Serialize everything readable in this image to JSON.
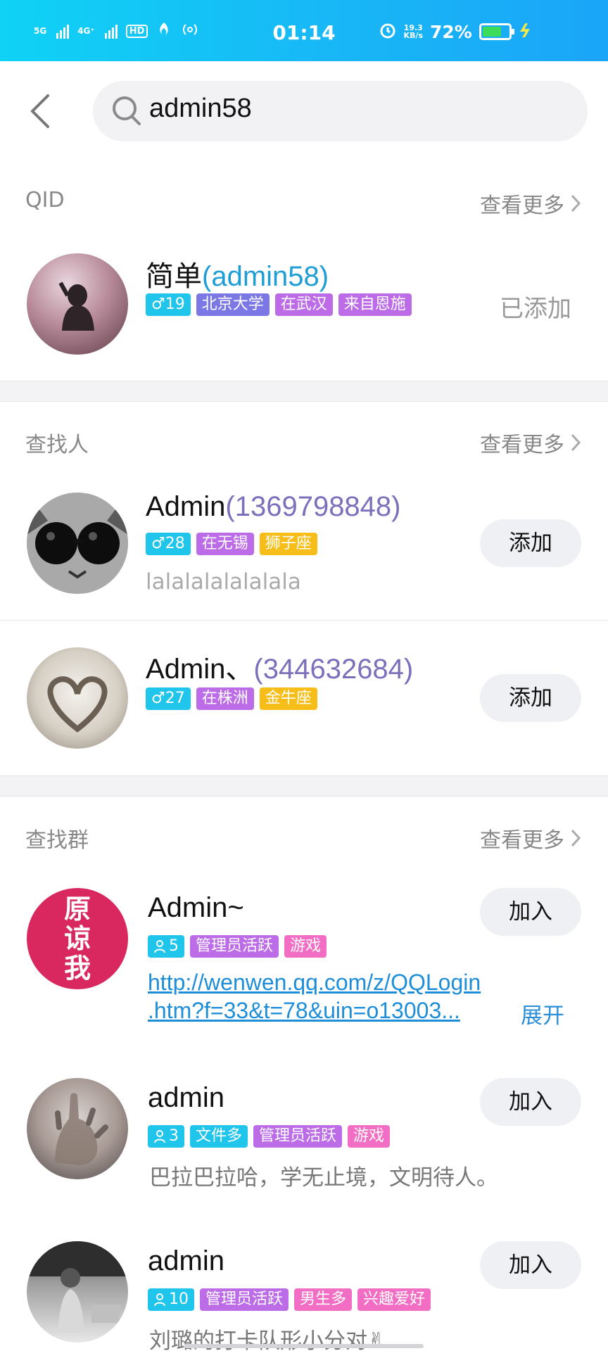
{
  "status_bar": {
    "net1": "5G",
    "net2": "4G⁺",
    "hd": "HD",
    "time": "01:14",
    "speed_value": "19.3",
    "speed_unit": "KB/s",
    "battery_pct": "72%"
  },
  "search": {
    "query": "admin58"
  },
  "sections": {
    "qid": {
      "title": "QID",
      "see_more": "查看更多",
      "items": [
        {
          "name": "简单",
          "id": "(admin58)",
          "tags": [
            "♂19",
            "北京大学",
            "在武汉",
            "来自恩施"
          ],
          "action": "已添加"
        }
      ]
    },
    "people": {
      "title": "查找人",
      "see_more": "查看更多",
      "items": [
        {
          "name": "Admin",
          "id": "(1369798848)",
          "tags": [
            "♂28",
            "在无锡",
            "狮子座"
          ],
          "subtitle": "lalalalalalalala",
          "action": "添加"
        },
        {
          "name": "Admin、",
          "id": "(344632684)",
          "tags": [
            "♂27",
            "在株洲",
            "金牛座"
          ],
          "action": "添加"
        }
      ]
    },
    "groups": {
      "title": "查找群",
      "see_more": "查看更多",
      "items": [
        {
          "name": "Admin~",
          "avatar_text": [
            "原",
            "谅",
            "我"
          ],
          "tags": [
            "5",
            "管理员活跃",
            "游戏"
          ],
          "link_line1": "http://wenwen.qq.com/z/QQLogin",
          "link_line2": ".htm?f=33&t=78&uin=o13003...",
          "expand": "展开",
          "action": "加入"
        },
        {
          "name": "admin",
          "tags": [
            "3",
            "文件多",
            "管理员活跃",
            "游戏"
          ],
          "subtitle": "巴拉巴拉哈，学无止境，文明待人。",
          "action": "加入"
        },
        {
          "name": "admin",
          "tags": [
            "10",
            "管理员活跃",
            "男生多",
            "兴趣爱好"
          ],
          "subtitle": "刘璐的打卡队形小分对✌",
          "action": "加入"
        }
      ]
    }
  },
  "colors": {
    "status_bar": "#18b7f6",
    "tag_cyan": "#1fc5ea",
    "tag_purple": "#bd6ce8",
    "tag_indigo": "#7b78e6",
    "tag_orange": "#f7be19",
    "tag_pink": "#f26ec4",
    "link": "#1f8ed8"
  },
  "icons": [
    "back-arrow-icon",
    "search-icon",
    "chevron-right-icon",
    "male-icon",
    "member-icon",
    "battery-icon",
    "alarm-icon",
    "charging-icon"
  ]
}
